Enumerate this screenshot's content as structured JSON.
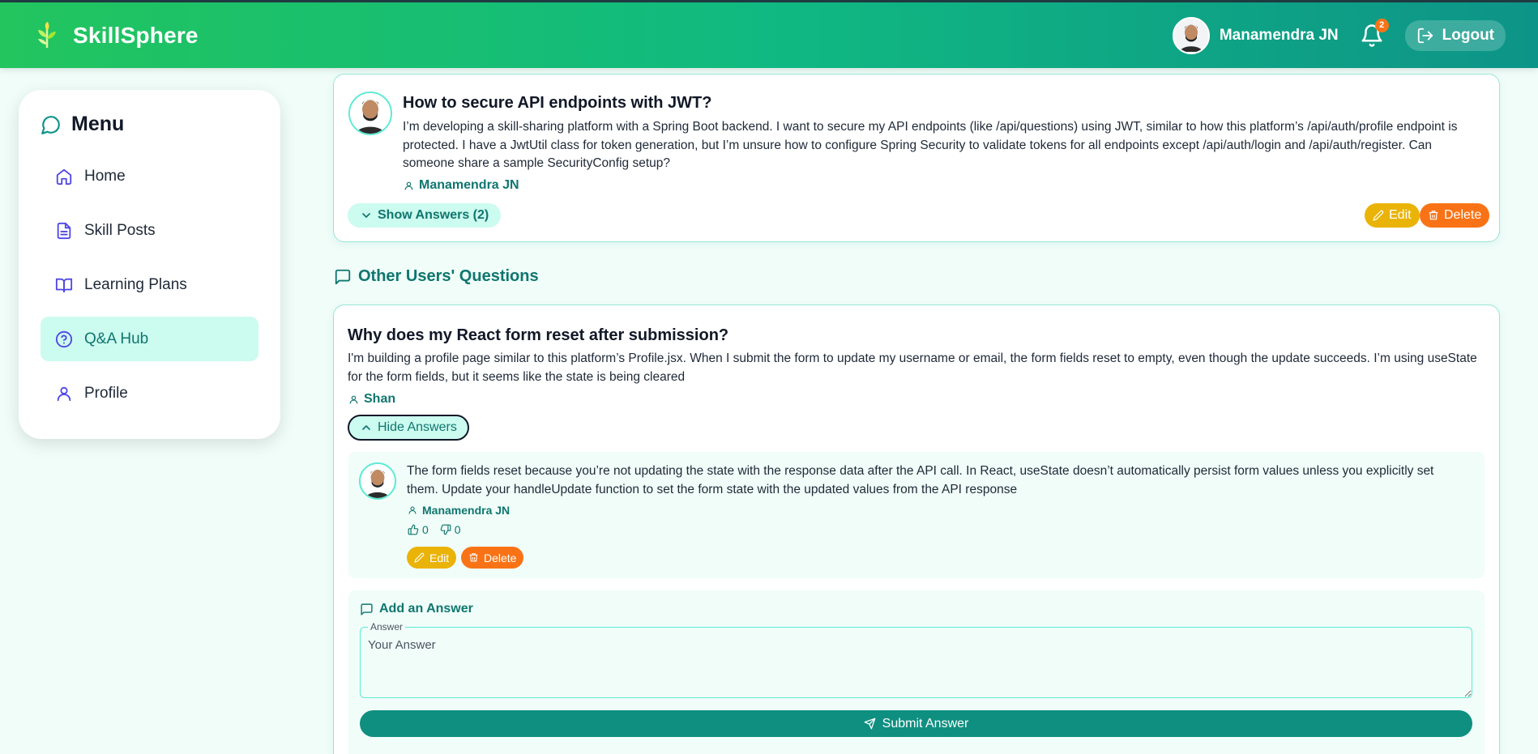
{
  "header": {
    "app_name": "SkillSphere",
    "user_name": "Manamendra JN",
    "notification_count": "2",
    "logout_label": "Logout"
  },
  "sidebar": {
    "title": "Menu",
    "items": [
      {
        "label": "Home",
        "icon": "home-icon"
      },
      {
        "label": "Skill Posts",
        "icon": "document-icon"
      },
      {
        "label": "Learning Plans",
        "icon": "book-icon"
      },
      {
        "label": "Q&A Hub",
        "icon": "question-circle-icon",
        "active": true
      },
      {
        "label": "Profile",
        "icon": "user-icon"
      }
    ]
  },
  "my_question": {
    "title": "How to secure API endpoints with JWT?",
    "body": "I’m developing a skill-sharing platform with a Spring Boot backend. I want to secure my API endpoints (like /api/questions) using JWT, similar to how this platform’s /api/auth/profile endpoint is protected. I have a JwtUtil class for token generation, but I’m unsure how to configure Spring Security to validate tokens for all endpoints except /api/auth/login and /api/auth/register. Can someone share a sample SecurityConfig setup?",
    "author": "Manamendra JN",
    "show_answers_label": "Show Answers (2)",
    "edit_label": "Edit",
    "delete_label": "Delete"
  },
  "other_section": {
    "heading": "Other Users' Questions"
  },
  "other_question": {
    "title": "Why does my React form reset after submission?",
    "body": "I'm building a profile page similar to this platform’s Profile.jsx. When I submit the form to update my username or email, the form fields reset to empty, even though the update succeeds. I’m using useState for the form fields, but it seems like the state is being cleared",
    "author": "Shan",
    "hide_answers_label": "Hide Answers"
  },
  "answer": {
    "body": "The form fields reset because you’re not updating the state with the response data after the API call. In React, useState doesn’t automatically persist form values unless you explicitly set them. Update your handleUpdate function to set the form state with the updated values from the API response",
    "author": "Manamendra JN",
    "likes": "0",
    "dislikes": "0",
    "edit_label": "Edit",
    "delete_label": "Delete"
  },
  "add_answer": {
    "heading": "Add an Answer",
    "field_label": "Answer",
    "placeholder": "Your Answer",
    "submit_label": "Submit Answer"
  },
  "colors": {
    "accent": "#0f766e",
    "header_start": "#22c55e",
    "header_end": "#0d9488",
    "edit": "#eab308",
    "delete": "#f97316"
  }
}
